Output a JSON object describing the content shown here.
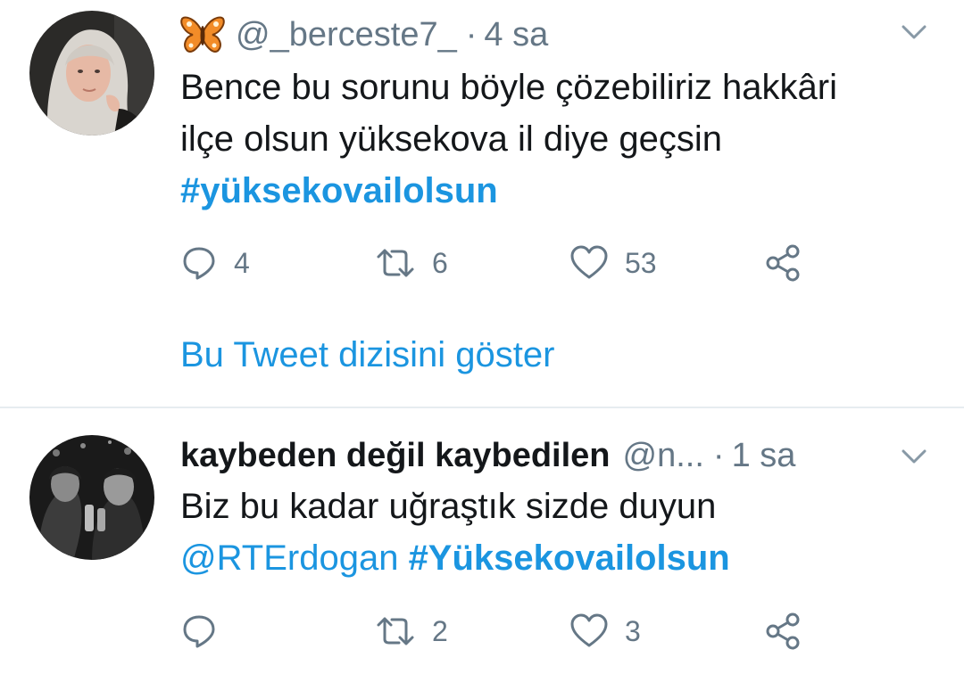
{
  "tweets": [
    {
      "emoji": "🦋",
      "name": "",
      "handle": "@_berceste7_",
      "time": "4 sa",
      "text_line1": "Bence bu sorunu böyle çözebiliriz hakkâri",
      "text_line2": "ilçe olsun yüksekova il diye geçsin",
      "hashtag": "#yüksekovailolsun",
      "reply_count": "4",
      "retweet_count": "6",
      "like_count": "53",
      "thread_link": "Bu Tweet dizisini göster"
    },
    {
      "name": "kaybeden değil kaybedilen",
      "handle": "@n...",
      "time": "1 sa",
      "text_line1": "Biz bu kadar uğraştık sizde duyun",
      "mention": "@RTErdogan",
      "hashtag": "#Yüksekovailolsun",
      "reply_count": "",
      "retweet_count": "2",
      "like_count": "3"
    }
  ],
  "icons": {
    "reply": "reply-bubble-icon",
    "retweet": "retweet-icon",
    "like": "heart-icon",
    "share": "share-icon",
    "menu": "chevron-down-icon",
    "emoji": "butterfly-emoji"
  },
  "colors": {
    "link": "#1b95e0",
    "text": "#14171a",
    "secondary": "#657786",
    "divider": "#e6ecf0"
  }
}
